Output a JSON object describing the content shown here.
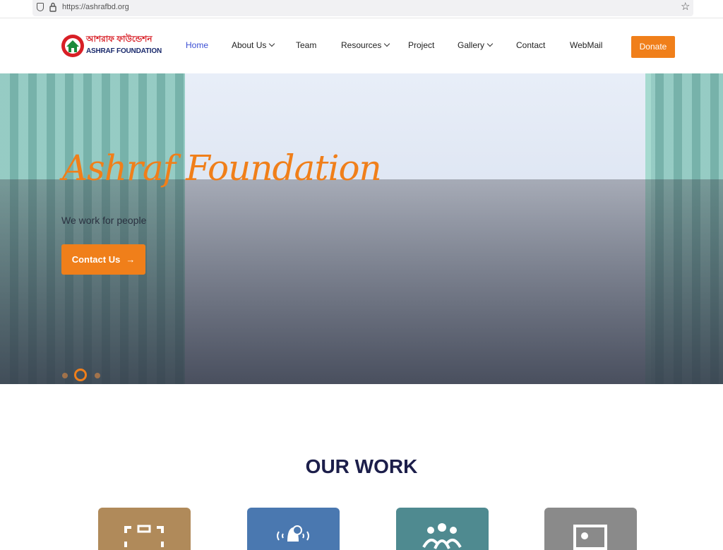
{
  "browser": {
    "url": "https://ashrafbd.org"
  },
  "logo": {
    "bangla": "আশরাফ ফাউন্ডেশন",
    "english": "ASHRAF FOUNDATION"
  },
  "nav": {
    "home": "Home",
    "about": "About Us",
    "team": "Team",
    "resources": "Resources",
    "project": "Project",
    "gallery": "Gallery",
    "contact": "Contact",
    "webmail": "WebMail",
    "donate": "Donate"
  },
  "hero": {
    "title": "Ashraf Foundation",
    "subtitle": "We work for people",
    "cta": "Contact Us",
    "active_slide": 2,
    "slide_count": 3
  },
  "section": {
    "title": "OUR WORK"
  },
  "cards": [
    {
      "icon": "camera-icon",
      "color": "#b08a5a"
    },
    {
      "icon": "bell-icon",
      "color": "#4a78b0"
    },
    {
      "icon": "group-icon",
      "color": "#4f8a90"
    },
    {
      "icon": "image-icon",
      "color": "#8a8a8a"
    }
  ],
  "colors": {
    "accent": "#f07f1a",
    "nav_active": "#3b4fd4",
    "heading": "#1c1e4a"
  }
}
